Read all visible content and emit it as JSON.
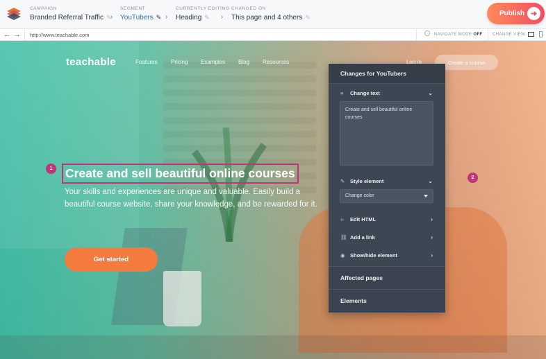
{
  "header": {
    "campaign": {
      "label": "CAMPAIGN",
      "value": "Branded Referral Traffic"
    },
    "segment": {
      "label": "SEGMENT",
      "value": "YouTubers"
    },
    "currently_editing": {
      "label": "CURRENTLY EDITING",
      "value": "Heading"
    },
    "changed_on": {
      "label": "CHANGED ON",
      "value": "This page and 4 others"
    },
    "publish_label": "Publish"
  },
  "browser": {
    "url": "http://www.teachable.com",
    "navigate_mode_label": "NAVIGATE MODE",
    "navigate_mode_value": "OFF",
    "change_view_label": "CHANGE VIEW:"
  },
  "site": {
    "brand": "teachable",
    "nav": [
      "Features",
      "Pricing",
      "Examples",
      "Blog",
      "Resources"
    ],
    "login": "Log in",
    "create_course": "Create a course",
    "headline": "Create and sell beautiful online courses",
    "subtext": "Your skills and experiences are unique and valuable. Easily build a beautiful course website, share your knowledge, and be rewarded for it.",
    "cta": "Get started",
    "markers": [
      "1",
      "2"
    ]
  },
  "panel": {
    "title": "Changes for YouTubers",
    "change_text_label": "Change text",
    "change_text_value": "Create and sell beautiful online courses",
    "style_element_label": "Style element",
    "change_color_label": "Change color",
    "edit_html_label": "Edit HTML",
    "add_link_label": "Add a link",
    "show_hide_label": "Show/hide element",
    "affected_pages_label": "Affected pages",
    "elements_label": "Elements"
  }
}
